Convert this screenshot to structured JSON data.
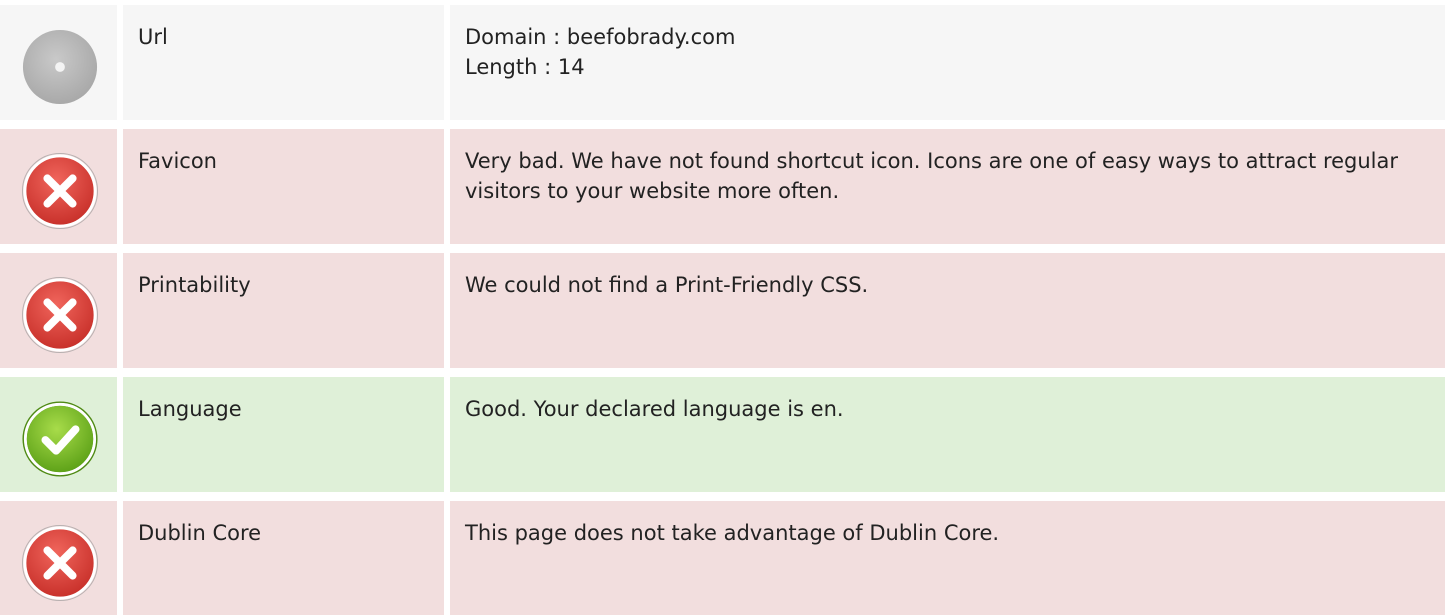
{
  "rows": [
    {
      "status": "neutral",
      "icon": "neutral-disc-icon",
      "label": "Url",
      "lines": [
        "Domain : beefobrady.com",
        "Length : 14"
      ]
    },
    {
      "status": "bad",
      "icon": "error-x-icon",
      "label": "Favicon",
      "lines": [
        "Very bad. We have not found shortcut icon. Icons are one of easy ways to attract regular visitors to your website more often."
      ]
    },
    {
      "status": "bad",
      "icon": "error-x-icon",
      "label": "Printability",
      "lines": [
        "We could not find a Print-Friendly CSS."
      ]
    },
    {
      "status": "good",
      "icon": "success-check-icon",
      "label": "Language",
      "lines": [
        "Good. Your declared language is en."
      ]
    },
    {
      "status": "bad",
      "icon": "error-x-icon",
      "label": "Dublin Core",
      "lines": [
        "This page does not take advantage of Dublin Core."
      ]
    }
  ],
  "colors": {
    "neutral_bg": "#f6f6f6",
    "bad_bg": "#f2dede",
    "good_bg": "#dff0d8",
    "error_red": "#e0453c",
    "success_green": "#7cc12a",
    "neutral_grey": "#bdbdbd"
  }
}
